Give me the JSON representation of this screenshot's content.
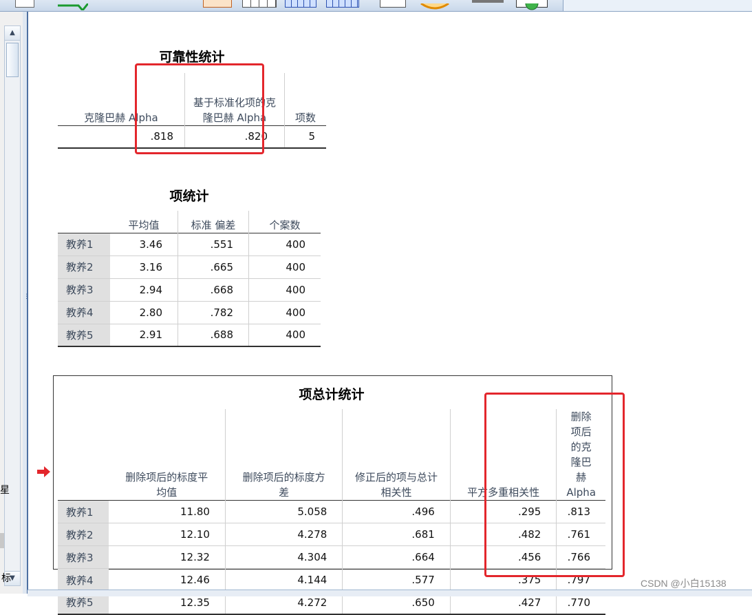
{
  "reliability": {
    "title": "可靠性统计",
    "headers": [
      "克隆巴赫 Alpha",
      "基于标准化项的克隆巴赫 Alpha",
      "项数"
    ],
    "values": [
      ".818",
      ".820",
      "5"
    ]
  },
  "item_stats": {
    "title": "项统计",
    "headers": [
      "平均值",
      "标准 偏差",
      "个案数"
    ],
    "rows": [
      {
        "label": "教养1",
        "cells": [
          "3.46",
          ".551",
          "400"
        ]
      },
      {
        "label": "教养2",
        "cells": [
          "3.16",
          ".665",
          "400"
        ]
      },
      {
        "label": "教养3",
        "cells": [
          "2.94",
          ".668",
          "400"
        ]
      },
      {
        "label": "教养4",
        "cells": [
          "2.80",
          ".782",
          "400"
        ]
      },
      {
        "label": "教养5",
        "cells": [
          "2.91",
          ".688",
          "400"
        ]
      }
    ]
  },
  "item_total": {
    "title": "项总计统计",
    "headers": [
      "删除项后的标度平均值",
      "删除项后的标度方差",
      "修正后的项与总计相关性",
      "平方多重相关性",
      "删除项后的克隆巴赫 Alpha"
    ],
    "rows": [
      {
        "label": "教养1",
        "cells": [
          "11.80",
          "5.058",
          ".496",
          ".295",
          ".813"
        ]
      },
      {
        "label": "教养2",
        "cells": [
          "12.10",
          "4.278",
          ".681",
          ".482",
          ".761"
        ]
      },
      {
        "label": "教养3",
        "cells": [
          "12.32",
          "4.304",
          ".664",
          ".456",
          ".766"
        ]
      },
      {
        "label": "教养4",
        "cells": [
          "12.46",
          "4.144",
          ".577",
          ".375",
          ".797"
        ]
      },
      {
        "label": "教养5",
        "cells": [
          "12.35",
          "4.272",
          ".650",
          ".427",
          ".770"
        ]
      }
    ]
  },
  "left_pane": {
    "clip_1": "星",
    "clip_2": "标"
  },
  "icons": {
    "scroll_up": "▲",
    "scroll_down": "▼",
    "splitter_grip": "⋮"
  },
  "colors": {
    "highlight": "#e3262c",
    "row_label_bg": "#e0e0e0"
  },
  "watermark": "CSDN @小白15138"
}
